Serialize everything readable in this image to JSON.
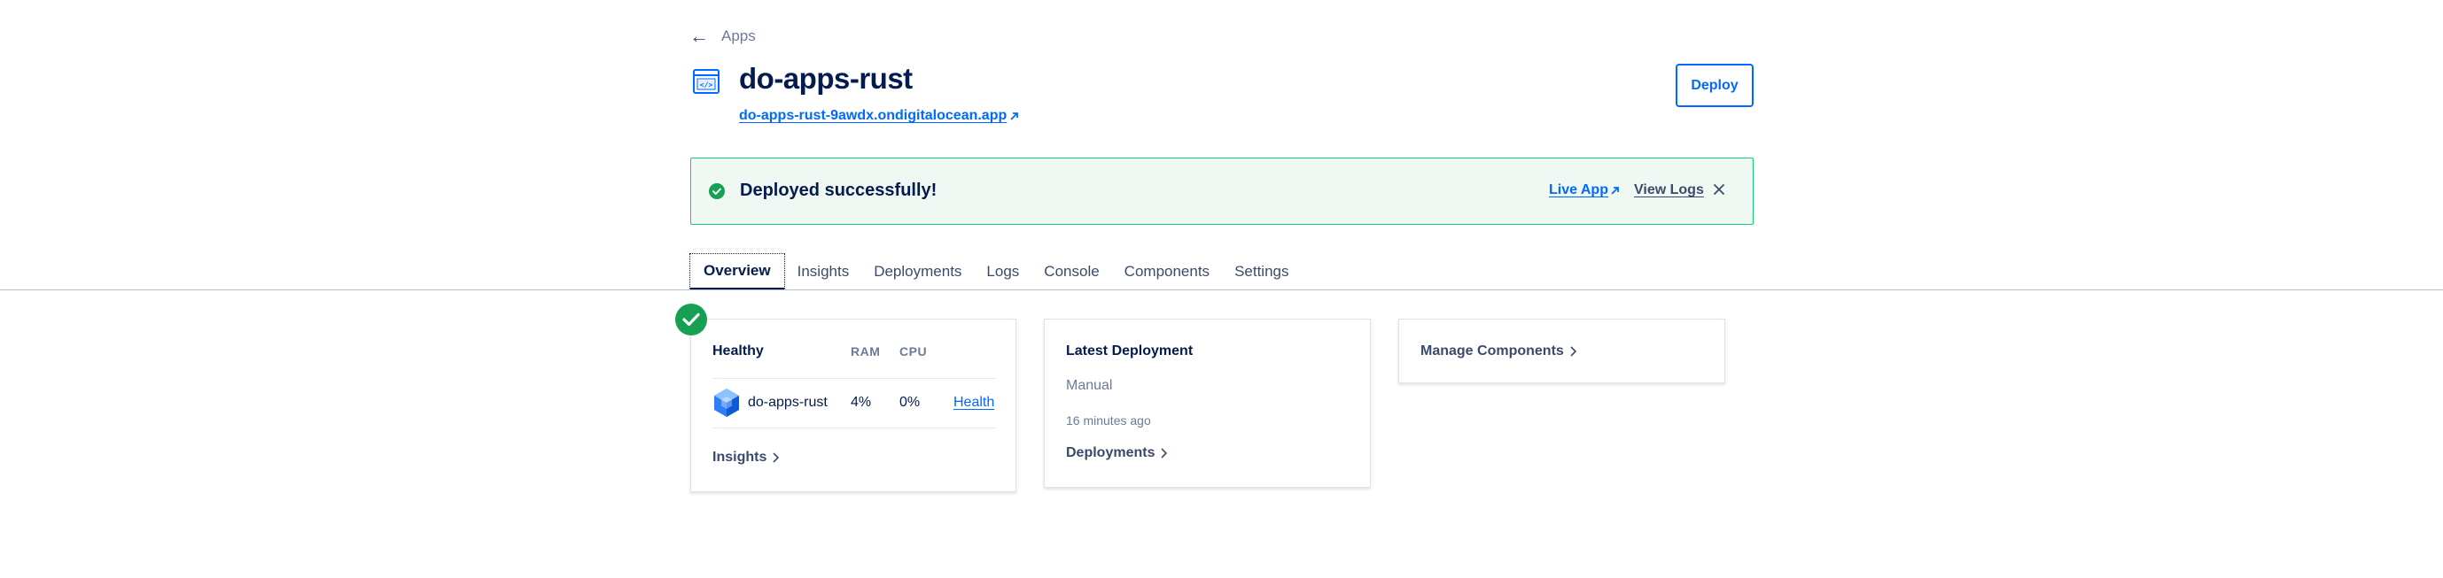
{
  "breadcrumb": {
    "back_label": "Apps"
  },
  "app": {
    "title": "do-apps-rust",
    "url": "do-apps-rust-9awdx.ondigitalocean.app",
    "deploy_label": "Deploy"
  },
  "banner": {
    "message": "Deployed successfully!",
    "live_app_label": "Live App",
    "view_logs_label": "View Logs"
  },
  "tabs": [
    {
      "label": "Overview",
      "active": true
    },
    {
      "label": "Insights"
    },
    {
      "label": "Deployments"
    },
    {
      "label": "Logs"
    },
    {
      "label": "Console"
    },
    {
      "label": "Components"
    },
    {
      "label": "Settings"
    }
  ],
  "health_card": {
    "title": "Healthy",
    "col_ram": "RAM",
    "col_cpu": "CPU",
    "component_name": "do-apps-rust",
    "ram": "4%",
    "cpu": "0%",
    "health_link": "Health",
    "insights_link": "Insights"
  },
  "deployment_card": {
    "title": "Latest Deployment",
    "type": "Manual",
    "time": "16 minutes ago",
    "deployments_link": "Deployments"
  },
  "components_card": {
    "link": "Manage Components"
  },
  "colors": {
    "primary": "#0069ff",
    "success": "#15a052",
    "text": "#031b4e",
    "muted": "#6b7a99",
    "banner_bg": "#f0f8f3",
    "banner_border": "#15cd72"
  },
  "icons": {
    "back": "arrow-left-icon",
    "app": "code-window-icon",
    "external": "external-link-icon",
    "success": "check-circle-icon",
    "close": "close-icon",
    "component": "hexagon-cube-icon",
    "chevron": "chevron-right-icon"
  }
}
